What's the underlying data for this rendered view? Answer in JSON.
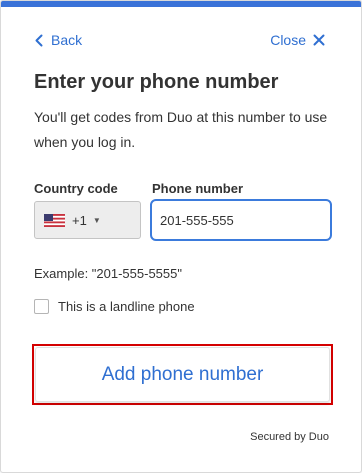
{
  "nav": {
    "back_label": "Back",
    "close_label": "Close"
  },
  "header": {
    "title": "Enter your phone number"
  },
  "description": "You'll get codes from Duo at this number to use when you log in.",
  "form": {
    "country_label": "Country code",
    "country_value": "+1",
    "phone_label": "Phone number",
    "phone_value": "201-555-555",
    "example": "Example: \"201-555-5555\"",
    "landline_label": "This is a landline phone",
    "landline_checked": false
  },
  "actions": {
    "submit_label": "Add phone number"
  },
  "footer": {
    "secured_label": "Secured by Duo"
  },
  "colors": {
    "accent": "#2f6fd1",
    "topbar": "#3a72d8",
    "focus_border": "#3b7bdc",
    "highlight": "#d40000"
  }
}
